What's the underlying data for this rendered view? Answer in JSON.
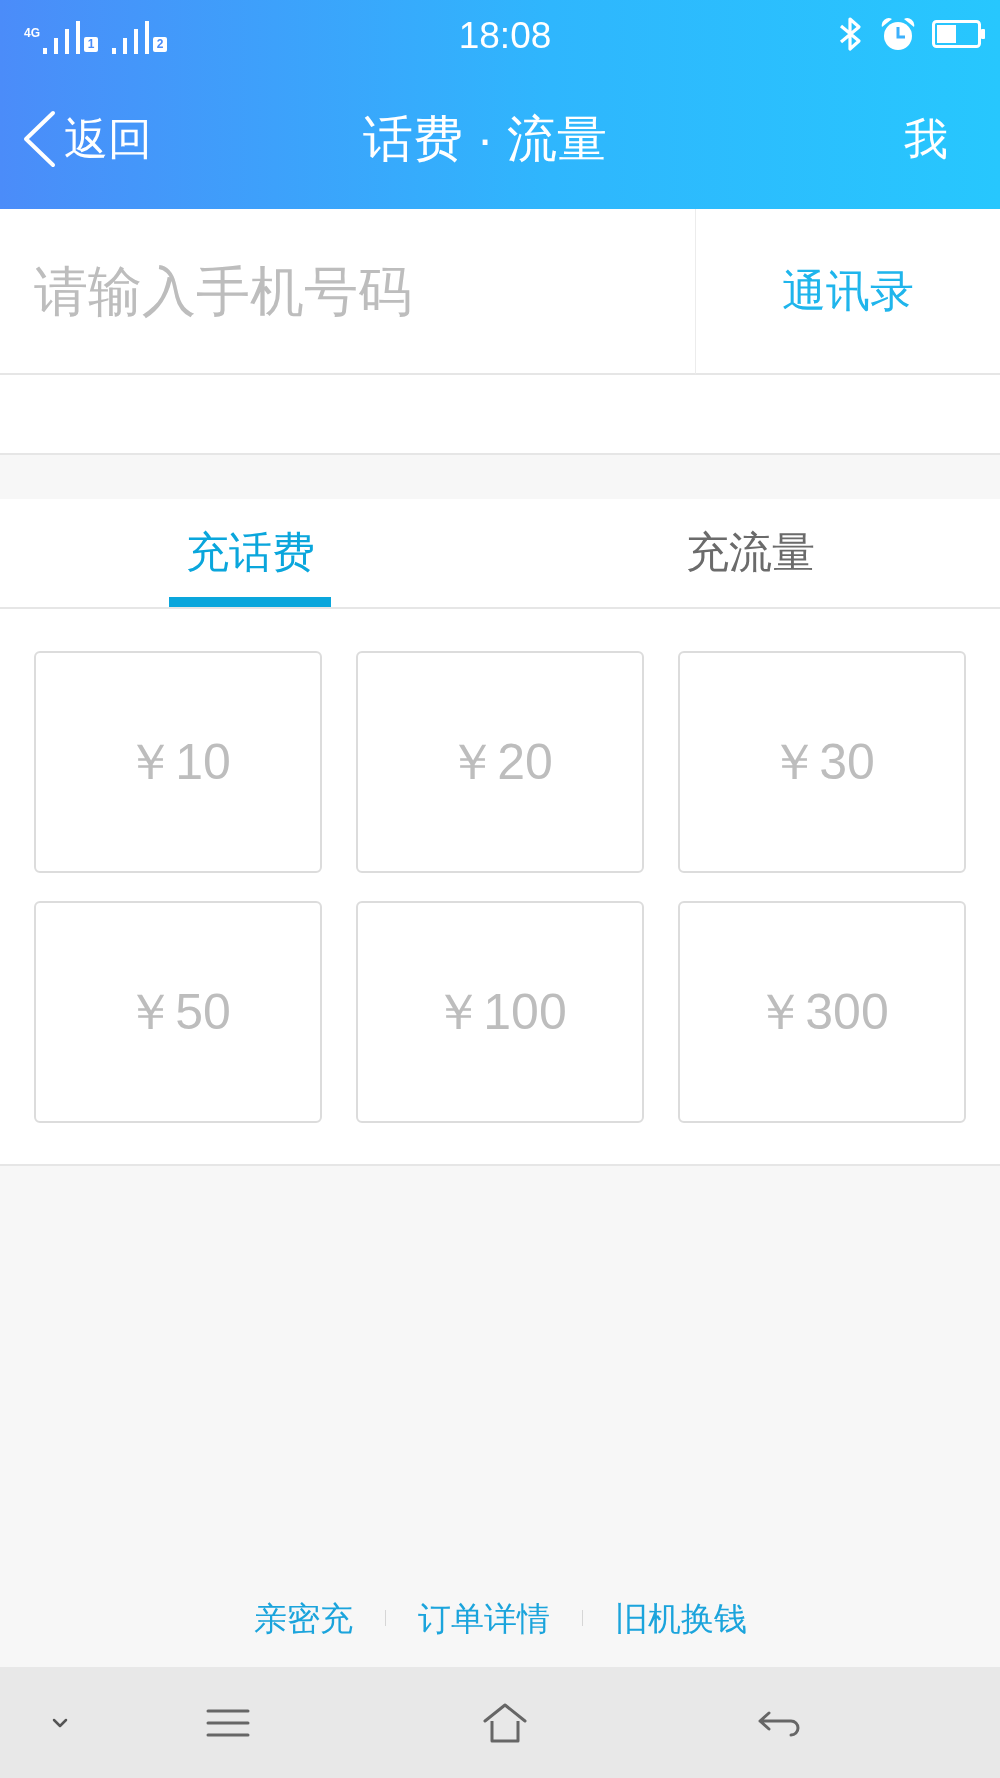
{
  "status_bar": {
    "network": "4G",
    "sims": [
      "1",
      "2"
    ],
    "time": "18:08"
  },
  "nav_bar": {
    "back_label": "返回",
    "title": "话费 · 流量",
    "profile_label": "我"
  },
  "phone_entry": {
    "placeholder": "请输入手机号码",
    "contacts_label": "通讯录"
  },
  "tabs": [
    {
      "label": "充话费",
      "selected": true
    },
    {
      "label": "充流量",
      "selected": false
    }
  ],
  "amounts": [
    "￥10",
    "￥20",
    "￥30",
    "￥50",
    "￥100",
    "￥300"
  ],
  "footer_links": [
    "亲密充",
    "订单详情",
    "旧机换钱"
  ]
}
